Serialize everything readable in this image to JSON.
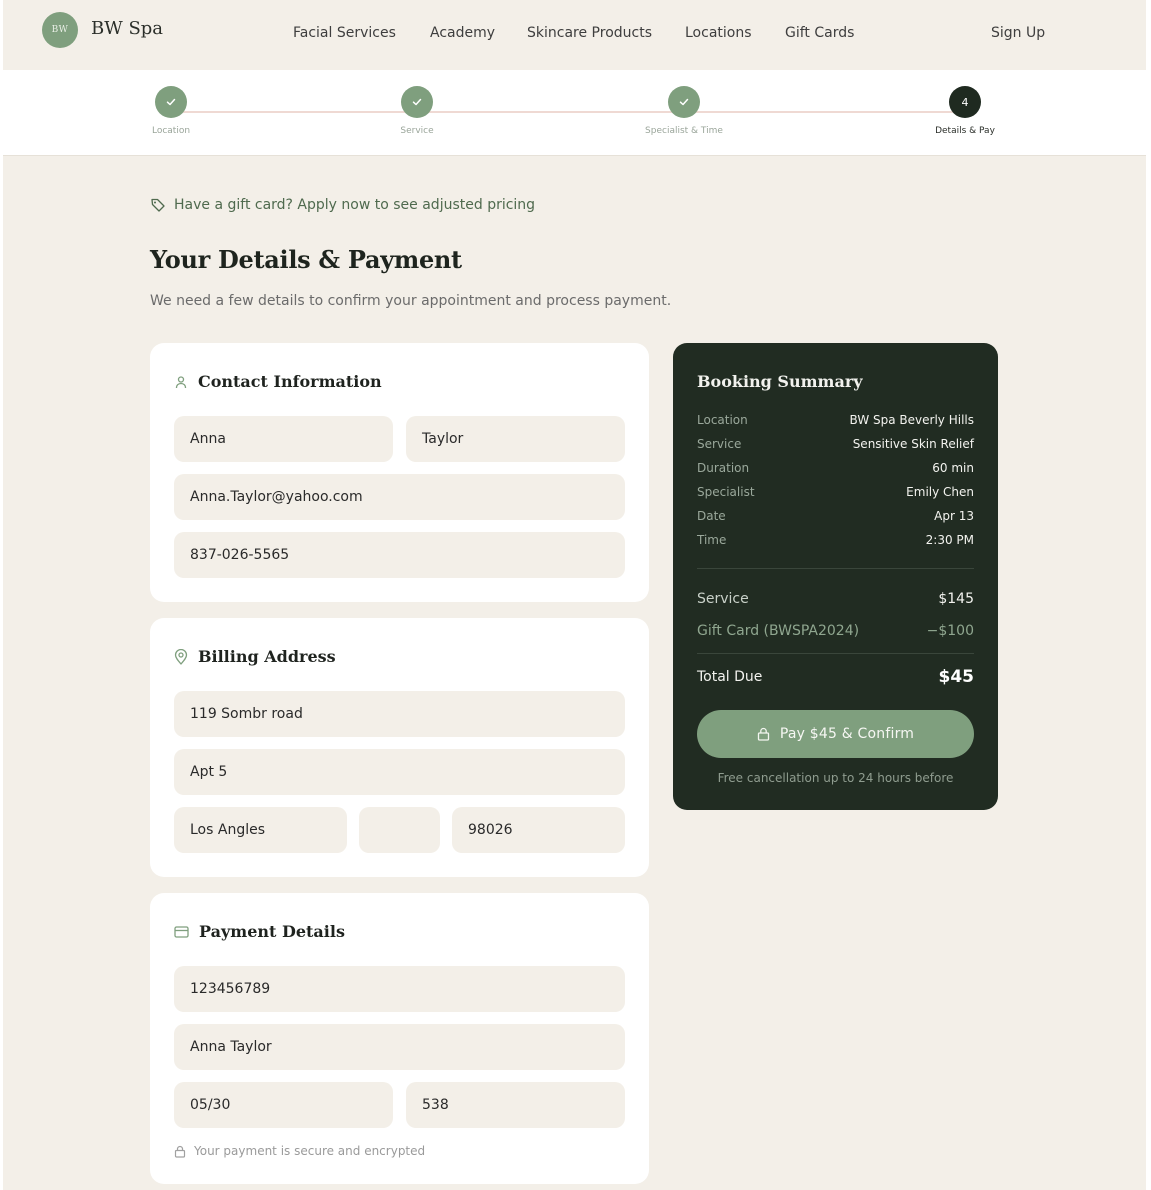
{
  "header": {
    "logo_text": "BW",
    "brand": "BW Spa",
    "nav": [
      "Facial Services",
      "Academy",
      "Skincare Products",
      "Locations",
      "Gift Cards"
    ],
    "signup": "Sign Up"
  },
  "stepper": {
    "steps": [
      {
        "label": "Location",
        "state": "done",
        "icon": "check-icon"
      },
      {
        "label": "Service",
        "state": "done",
        "icon": "check-icon"
      },
      {
        "label": "Specialist & Time",
        "state": "done",
        "icon": "check-icon"
      },
      {
        "label": "Details & Pay",
        "state": "current",
        "number": "4"
      }
    ]
  },
  "gift_banner": {
    "text": "Have a gift card? Apply now to see adjusted pricing",
    "icon": "tag-icon"
  },
  "page": {
    "title": "Your Details & Payment",
    "subtitle": "We need a few details to confirm your appointment and process payment."
  },
  "contact": {
    "title": "Contact Information",
    "icon": "user-icon",
    "first_name": "Anna",
    "last_name": "Taylor",
    "email": "Anna.Taylor@yahoo.com",
    "phone": "837-026-5565"
  },
  "billing": {
    "title": "Billing Address",
    "icon": "map-pin-icon",
    "street": "119 Sombr road",
    "apt": "Apt 5",
    "city": "Los Angles",
    "state": "",
    "zip": "98026"
  },
  "payment": {
    "title": "Payment Details",
    "icon": "credit-card-icon",
    "card_number": "123456789",
    "name_on_card": "Anna Taylor",
    "expiry": "05/30",
    "cvv": "538",
    "secure_note": "Your payment is secure and encrypted"
  },
  "summary": {
    "title": "Booking Summary",
    "rows": [
      {
        "k": "Location",
        "v": "BW Spa Beverly Hills"
      },
      {
        "k": "Service",
        "v": "Sensitive Skin Relief"
      },
      {
        "k": "Duration",
        "v": "60 min"
      },
      {
        "k": "Specialist",
        "v": "Emily Chen"
      },
      {
        "k": "Date",
        "v": "Apr 13"
      },
      {
        "k": "Time",
        "v": "2:30 PM"
      }
    ],
    "service_label": "Service",
    "service_price": "$145",
    "gift_label": "Gift Card (BWSPA2024)",
    "gift_price": "−$100",
    "total_label": "Total Due",
    "total_price": "$45",
    "pay_button": "Pay $45 & Confirm",
    "cancel_note": "Free cancellation up to 24 hours before"
  },
  "colors": {
    "accent": "#7f9f7e",
    "dark": "#212c22",
    "background": "#f3efe8"
  }
}
